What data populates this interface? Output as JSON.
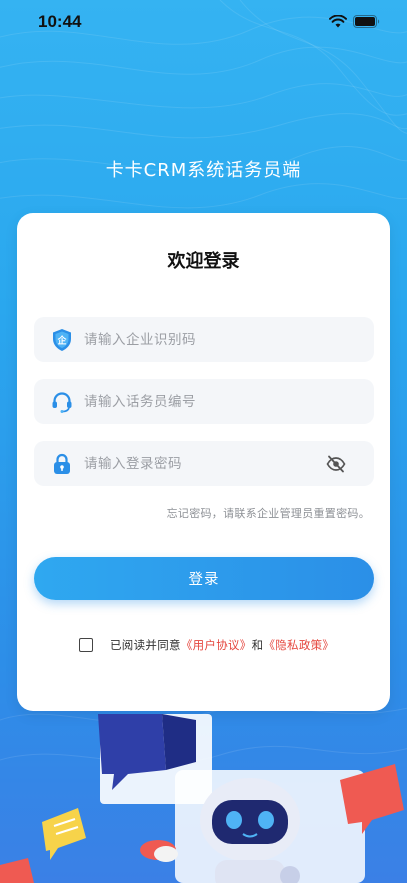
{
  "status": {
    "time": "10:44"
  },
  "app": {
    "title": "卡卡CRM系统话务员端"
  },
  "login": {
    "heading": "欢迎登录",
    "fields": [
      {
        "name": "company-code",
        "placeholder": "请输入企业识别码",
        "value": "",
        "icon": "company-shield-icon"
      },
      {
        "name": "agent-id",
        "placeholder": "请输入话务员编号",
        "value": "",
        "icon": "headset-icon"
      },
      {
        "name": "password",
        "placeholder": "请输入登录密码",
        "value": "",
        "icon": "lock-icon"
      }
    ],
    "forgot_hint": "忘记密码，请联系企业管理员重置密码。",
    "submit_label": "登录",
    "agreement": {
      "checked": false,
      "prefix": "已阅读并同意",
      "user_agreement": "《用户协议》",
      "and": "和",
      "privacy_policy": "《隐私政策》"
    }
  },
  "colors": {
    "primary": "#2b8fe7",
    "link": "#e5473f",
    "background_top": "#35b3f2",
    "background_bottom": "#3b80e6"
  }
}
